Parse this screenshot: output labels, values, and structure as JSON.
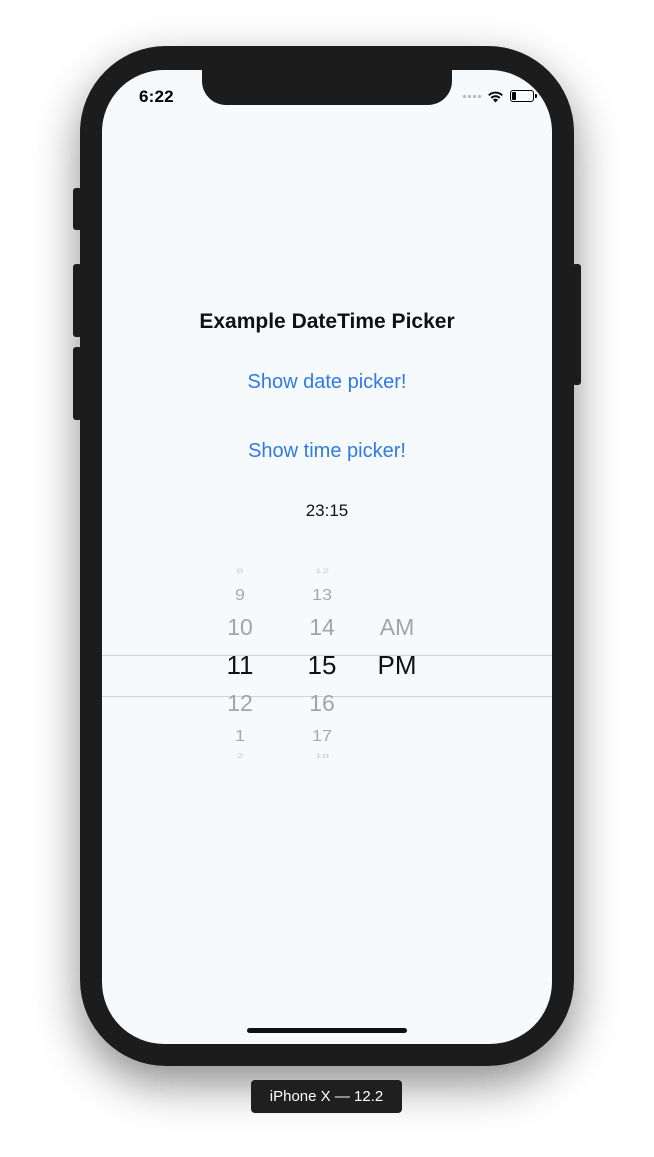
{
  "status_bar": {
    "time": "6:22"
  },
  "app": {
    "title": "Example DateTime Picker",
    "show_date_label": "Show date picker!",
    "show_time_label": "Show time picker!",
    "selected_value": "23:15"
  },
  "picker": {
    "hours": [
      "8",
      "9",
      "10",
      "11",
      "12",
      "1",
      "2"
    ],
    "minutes": [
      "12",
      "13",
      "14",
      "15",
      "16",
      "17",
      "18"
    ],
    "ampm": [
      "AM",
      "PM"
    ],
    "selected": {
      "hour": "11",
      "minute": "15",
      "period": "PM"
    }
  },
  "device_label": "iPhone X — 12.2",
  "colors": {
    "link": "#2f7ae5",
    "screen_bg": "#f6fafd",
    "bezel": "#1c1c1d"
  }
}
